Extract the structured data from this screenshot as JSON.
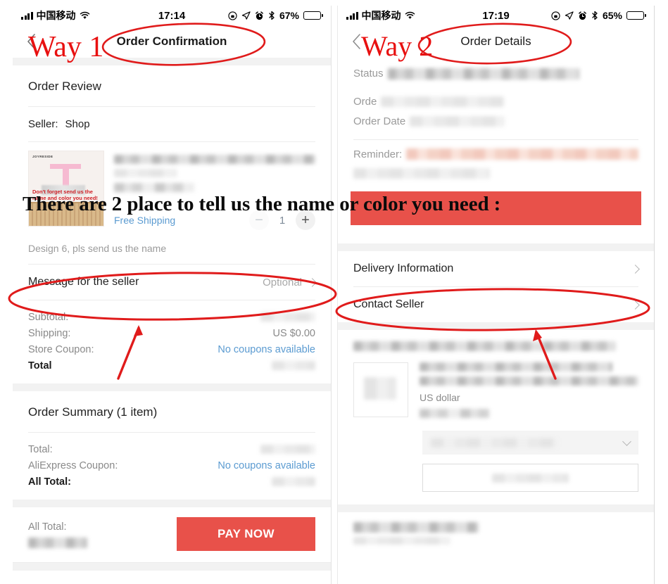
{
  "annotation": {
    "overlay_text": "There are 2 place to tell us the name or color you need :",
    "accent_red": "#e8514a",
    "marker_red": "#e01b1b",
    "way1_label": "Way 1",
    "way2_label": "Way 2"
  },
  "left_panel": {
    "status_bar": {
      "carrier": "中国移动",
      "time": "17:14",
      "battery_percent": "67%",
      "icons": [
        "signal-bars-icon",
        "wifi-icon",
        "rotation-lock-icon",
        "location-arrow-icon",
        "alarm-clock-icon",
        "bluetooth-icon",
        "battery-icon"
      ]
    },
    "nav": {
      "back_icon": "chevron-left-icon",
      "title": "Order Confirmation"
    },
    "order_review": {
      "section_title": "Order Review",
      "seller_label": "Seller:",
      "seller_name": "Shop",
      "product": {
        "thumb_brand": "JOYRESIDE",
        "thumb_caption": "Don't forget send us the name and color you need!",
        "shipping_label": "Free Shipping",
        "quantity": "1",
        "minus_icon": "minus-icon",
        "plus_icon": "plus-icon",
        "variant": "Design 6, pls send us the name"
      },
      "message_row": {
        "label": "Message for the seller",
        "value": "Optional",
        "chevron": "chevron-right-icon"
      },
      "prices": [
        {
          "key": "Subtotal:",
          "value": "",
          "type": "blurred"
        },
        {
          "key": "Shipping:",
          "value": "US $0.00",
          "type": "text"
        },
        {
          "key": "Store Coupon:",
          "value": "No coupons available",
          "type": "link"
        },
        {
          "key": "Total",
          "value": "",
          "type": "blurred-bold"
        }
      ]
    },
    "order_summary": {
      "section_title": "Order Summary (1 item)",
      "rows": [
        {
          "key": "Total:",
          "value": "",
          "type": "blurred"
        },
        {
          "key": "AliExpress Coupon:",
          "value": "No coupons available",
          "type": "link"
        },
        {
          "key": "All Total:",
          "value": "",
          "type": "blurred-bold"
        }
      ]
    },
    "pay_bar": {
      "total_label": "All Total:",
      "total_value": "",
      "pay_button": "PAY NOW"
    }
  },
  "right_panel": {
    "status_bar": {
      "carrier": "中国移动",
      "time": "17:19",
      "battery_percent": "65%",
      "icons": [
        "signal-bars-icon",
        "wifi-icon",
        "rotation-lock-icon",
        "location-arrow-icon",
        "alarm-clock-icon",
        "bluetooth-icon",
        "battery-icon"
      ]
    },
    "nav": {
      "back_icon": "chevron-left-icon",
      "title": "Order Details"
    },
    "order_info": {
      "status_label": "Status",
      "order_label": "Orde",
      "order_date_label": "Order Date",
      "reminder_label": "Reminder:"
    },
    "links": [
      {
        "label": "Delivery Information",
        "chevron": "chevron-right-icon"
      },
      {
        "label": "Contact Seller",
        "chevron": "chevron-right-icon"
      }
    ],
    "item": {
      "currency_note": "US dollar",
      "select_chevron": "chevron-down-icon"
    }
  }
}
